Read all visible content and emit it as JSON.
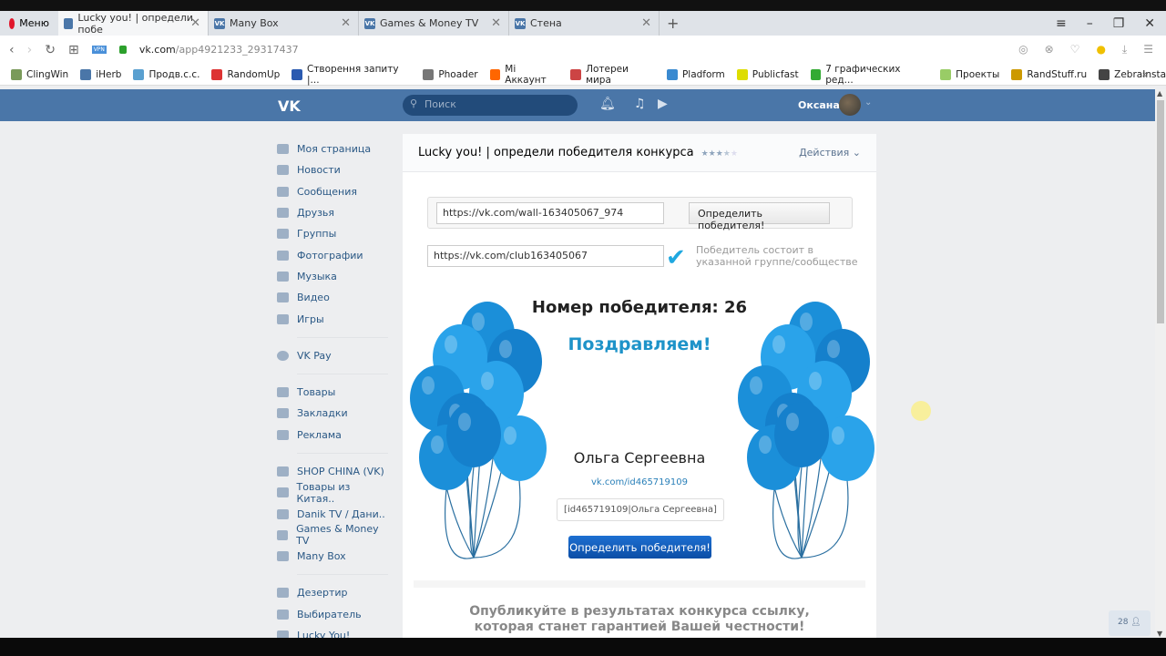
{
  "browser": {
    "menu_label": "Меню",
    "tabs": [
      {
        "label": "Lucky you! | определи побе",
        "active": true
      },
      {
        "label": "Many Box"
      },
      {
        "label": "Games & Money TV"
      },
      {
        "label": "Стена"
      }
    ],
    "url_domain": "vk.com",
    "url_path": "/app4921233_29317437",
    "bookmarks": [
      "ClingWin",
      "iHerb",
      "Продв.с.с.",
      "RandomUp",
      "Створення запиту |...",
      "Phoader",
      "Mi Аккаунт",
      "Лотереи мира",
      "Pladform",
      "Publicfast",
      "7 графических ред...",
      "Проекты",
      "RandStuff.ru",
      "ZebraInsta"
    ]
  },
  "vk": {
    "logo": "VK",
    "search_placeholder": "Поиск",
    "user_name": "Оксана",
    "brand_color": "#4a76a8"
  },
  "sidebar": {
    "groups": [
      [
        "Моя страница",
        "Новости",
        "Сообщения",
        "Друзья",
        "Группы",
        "Фотографии",
        "Музыка",
        "Видео",
        "Игры"
      ],
      [
        "VK Pay"
      ],
      [
        "Товары",
        "Закладки",
        "Реклама"
      ],
      [
        "SHOP CHINA (VK)",
        "Товары из Китая..",
        "Danik TV / Дани..",
        "Games & Money TV",
        "Many Box"
      ],
      [
        "Дезертир",
        "Выбиратель",
        "Lucky You!"
      ]
    ]
  },
  "app": {
    "title": "Lucky you! | определи победителя конкурса",
    "rating": "3.5 of 5",
    "actions_label": "Действия",
    "post_url": "https://vk.com/wall-163405067_974",
    "determine_label": "Определить победителя!",
    "group_url": "https://vk.com/club163405067",
    "group_check_text": "Победитель состоит в указанной группе/сообществе",
    "winner_number_label": "Номер победителя: 26",
    "congrats": "Поздравляем!",
    "winner_name": "Ольга Сергеевна",
    "winner_link": "vk.com/id465719109",
    "winner_code": "[id465719109|Ольга Сергеевна]",
    "determine_button": "Определить победителя!",
    "publish_text_1": "Опубликуйте в результатах конкурса ссылку,",
    "publish_text_2": "которая станет гарантией Вашей честности!"
  },
  "badge": {
    "count": "28"
  }
}
